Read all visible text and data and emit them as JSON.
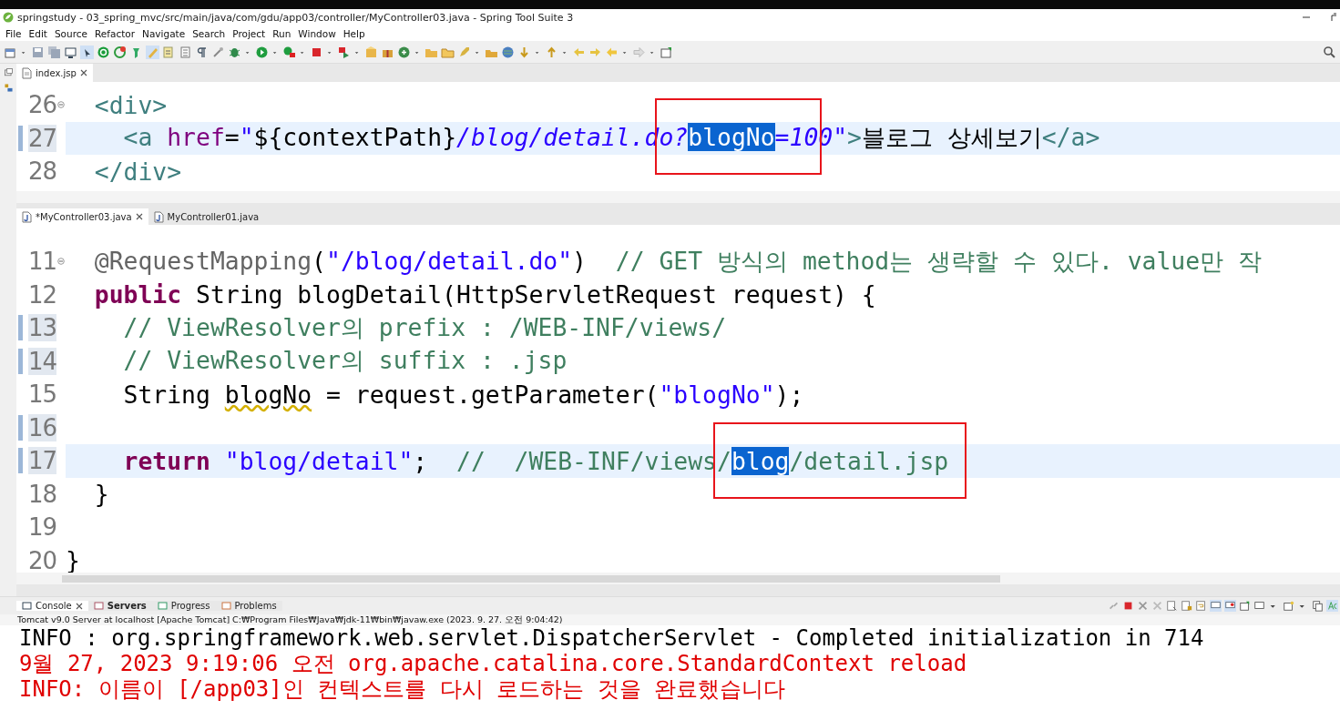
{
  "window": {
    "title": "springstudy - 03_spring_mvc/src/main/java/com/gdu/app03/controller/MyController03.java - Spring Tool Suite 3"
  },
  "menu": [
    "File",
    "Edit",
    "Source",
    "Refactor",
    "Navigate",
    "Search",
    "Project",
    "Run",
    "Window",
    "Help"
  ],
  "editors": [
    {
      "tabs": [
        {
          "label": "index.jsp",
          "selected": true,
          "closable": true,
          "kind": "jsp"
        }
      ],
      "lines": [
        {
          "number": "26",
          "fold": true,
          "current": false,
          "changed": false,
          "tokens": [
            {
              "text": "  <div>",
              "kind": "tag"
            }
          ]
        },
        {
          "number": "27",
          "fold": false,
          "current": true,
          "changed": true,
          "tokens": [
            {
              "text": "    <a",
              "kind": "tag"
            },
            {
              "text": " href",
              "kind": "attr"
            },
            {
              "text": "=",
              "kind": "plain"
            },
            {
              "text": "\"",
              "kind": "jsp"
            },
            {
              "text": "${contextPath}",
              "kind": "plain"
            },
            {
              "text": "/blog/detail.d",
              "kind": "jsp"
            },
            {
              "text": "o?",
              "kind": "jsp",
              "boxed": true
            },
            {
              "text": "blogNo",
              "kind": "selected",
              "boxed": true
            },
            {
              "text": "=10",
              "kind": "jsp",
              "boxed": true
            },
            {
              "text": "0\"",
              "kind": "jsp",
              "boxed": false
            },
            {
              "text": ">",
              "kind": "tag"
            },
            {
              "text": "블로그 상세보기",
              "kind": "plain"
            },
            {
              "text": "</a>",
              "kind": "tag"
            }
          ]
        },
        {
          "number": "28",
          "fold": false,
          "current": false,
          "changed": false,
          "tokens": [
            {
              "text": "  </div>",
              "kind": "tag"
            }
          ]
        }
      ]
    },
    {
      "tabs": [
        {
          "label": "*MyController03.java",
          "selected": true,
          "closable": true,
          "kind": "java"
        },
        {
          "label": "MyController01.java",
          "selected": false,
          "closable": false,
          "kind": "java"
        }
      ],
      "lines": [
        {
          "number": "11",
          "fold": true,
          "current": false,
          "changed": false,
          "tokens": [
            {
              "text": "  @RequestMapping",
              "kind": "annotation"
            },
            {
              "text": "(",
              "kind": "plain"
            },
            {
              "text": "\"/blog/detail.do\"",
              "kind": "string"
            },
            {
              "text": ")  ",
              "kind": "plain"
            },
            {
              "text": "// GET 방식의 method는 생략할 수 있다. value만 작",
              "kind": "comment"
            }
          ]
        },
        {
          "number": "12",
          "fold": false,
          "current": false,
          "changed": false,
          "tokens": [
            {
              "text": "  public",
              "kind": "keyword"
            },
            {
              "text": " String blogDetail(HttpServletRequest request) {",
              "kind": "plain"
            }
          ]
        },
        {
          "number": "13",
          "fold": false,
          "current": false,
          "changed": true,
          "tokens": [
            {
              "text": "    // ViewResolver의 prefix : /WEB-INF/views/",
              "kind": "comment"
            }
          ]
        },
        {
          "number": "14",
          "fold": false,
          "current": false,
          "changed": true,
          "tokens": [
            {
              "text": "    // ViewResolver의 suffix : .jsp",
              "kind": "comment"
            }
          ]
        },
        {
          "number": "15",
          "fold": false,
          "current": false,
          "changed": false,
          "tokens": [
            {
              "text": "    String ",
              "kind": "plain"
            },
            {
              "text": "blogNo",
              "kind": "warning"
            },
            {
              "text": " = request.getParameter(",
              "kind": "plain"
            },
            {
              "text": "\"blogNo\"",
              "kind": "string"
            },
            {
              "text": ");",
              "kind": "plain"
            }
          ]
        },
        {
          "number": "16",
          "fold": false,
          "current": false,
          "changed": true
        },
        {
          "number": "17",
          "fold": false,
          "current": true,
          "changed": true,
          "tokens": [
            {
              "text": "    return",
              "kind": "keyword"
            },
            {
              "text": " \"blog/detail\"",
              "kind": "string"
            },
            {
              "text": ";  ",
              "kind": "plain"
            },
            {
              "text": "//  /WEB-INF/views",
              "kind": "comment"
            },
            {
              "text": "/",
              "kind": "comment",
              "boxed": true
            },
            {
              "text": "blog",
              "kind": "selected",
              "boxed": true
            },
            {
              "text": "/detail.jsp ",
              "kind": "comment",
              "boxed": true
            }
          ]
        },
        {
          "number": "18",
          "fold": false,
          "current": false,
          "changed": false,
          "tokens": [
            {
              "text": "  }",
              "kind": "plain"
            }
          ]
        },
        {
          "number": "19",
          "fold": false,
          "current": false,
          "changed": false
        },
        {
          "number": "20",
          "fold": false,
          "current": false,
          "changed": false,
          "tokens": [
            {
              "text": "}",
              "kind": "plain"
            }
          ]
        }
      ]
    }
  ],
  "console": {
    "tabs": [
      {
        "label": "Console",
        "selected": true,
        "bold": false,
        "closable": true
      },
      {
        "label": "Servers",
        "selected": false,
        "bold": true,
        "closable": false
      },
      {
        "label": "Progress",
        "selected": false,
        "bold": false,
        "closable": false
      },
      {
        "label": "Problems",
        "selected": false,
        "bold": false,
        "closable": false
      }
    ],
    "header": "Tomcat v9.0 Server at localhost [Apache Tomcat] C:₩Program Files₩Java₩jdk-11₩bin₩javaw.exe  (2023. 9. 27. 오전 9:04:42)",
    "lines": [
      {
        "text": "INFO : org.springframework.web.servlet.DispatcherServlet - Completed initialization in 714",
        "kind": "stdout"
      },
      {
        "text": "9월 27, 2023 9:19:06 오전 org.apache.catalina.core.StandardContext reload",
        "kind": "stderr"
      },
      {
        "text": "INFO: 이름이 [/app03]인 컨텍스트를 다시 로드하는 것을 완료했습니다",
        "kind": "stderr"
      }
    ]
  }
}
